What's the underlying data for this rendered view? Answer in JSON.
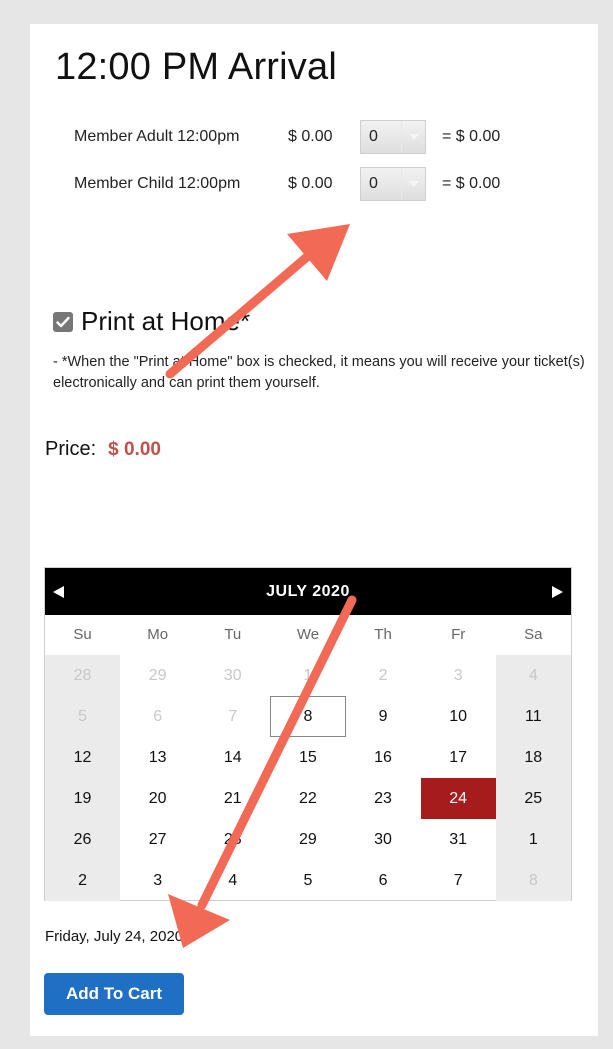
{
  "session": {
    "title": "12:00 PM Arrival"
  },
  "tickets": [
    {
      "name": "Member Adult 12:00pm",
      "price": "$ 0.00",
      "quantity": "0",
      "total": "= $ 0.00"
    },
    {
      "name": "Member Child 12:00pm",
      "price": "$ 0.00",
      "quantity": "0",
      "total": "= $ 0.00"
    }
  ],
  "print_at_home": {
    "checked": true,
    "label": "Print at Home*",
    "note": "- *When the \"Print at Home\" box is checked, it means you will receive your ticket(s) electronically and can print them yourself."
  },
  "price": {
    "label": "Price:",
    "amount": "$ 0.00"
  },
  "calendar": {
    "month_label": "JULY 2020",
    "weekdays": [
      "Su",
      "Mo",
      "Tu",
      "We",
      "Th",
      "Fr",
      "Sa"
    ],
    "weeks": [
      [
        "28",
        "29",
        "30",
        "1",
        "2",
        "3",
        "4"
      ],
      [
        "5",
        "6",
        "7",
        "8",
        "9",
        "10",
        "11"
      ],
      [
        "12",
        "13",
        "14",
        "15",
        "16",
        "17",
        "18"
      ],
      [
        "19",
        "20",
        "21",
        "22",
        "23",
        "24",
        "25"
      ],
      [
        "26",
        "27",
        "28",
        "29",
        "30",
        "31",
        "1"
      ],
      [
        "2",
        "3",
        "4",
        "5",
        "6",
        "7",
        "8"
      ]
    ],
    "muted_days": [
      "0-0",
      "0-1",
      "0-2",
      "0-3",
      "0-4",
      "0-5",
      "0-6",
      "1-0",
      "1-1",
      "1-2",
      "5-6"
    ],
    "today": "1-3",
    "selected": "3-5"
  },
  "selected_date_text": "Friday, July 24, 2020",
  "add_to_cart_label": "Add To Cart",
  "colors": {
    "accent_blue": "#1f6fc5",
    "selected_red": "#a61c1c",
    "price_red": "#c0504d",
    "annotation_arrow": "#f26a55"
  }
}
